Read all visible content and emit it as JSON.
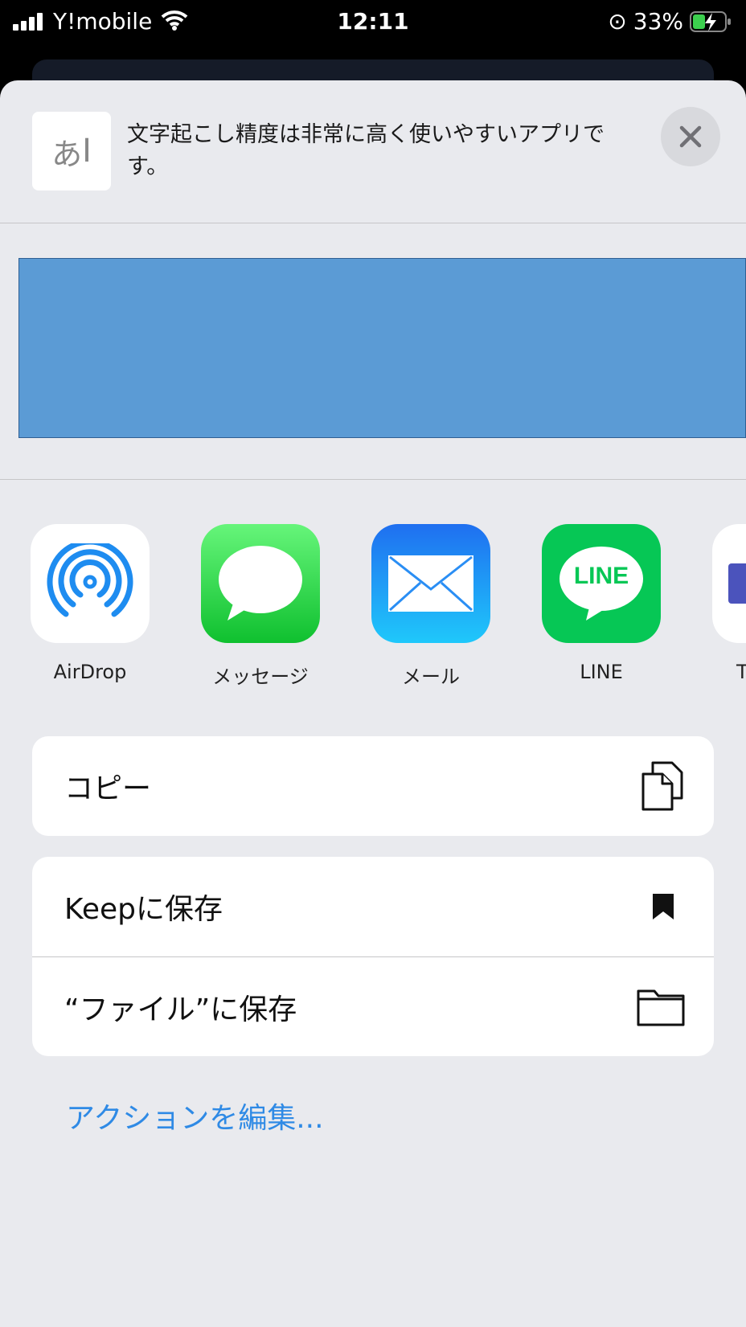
{
  "status_bar": {
    "carrier": "Y!mobile",
    "time": "12:11",
    "battery": "33%"
  },
  "header": {
    "thumbnail_glyph": "あ",
    "text": "文字起こし精度は非常に高く使いやすいアプリです。"
  },
  "preview": {
    "color": "#5b9bd5"
  },
  "apps": [
    {
      "label": "AirDrop",
      "icon": "airdrop-icon"
    },
    {
      "label": "メッセージ",
      "icon": "messages-icon"
    },
    {
      "label": "メール",
      "icon": "mail-icon"
    },
    {
      "label": "LINE",
      "icon": "line-icon",
      "logo_text": "LINE"
    },
    {
      "label": "T",
      "icon": "partial-app-icon"
    }
  ],
  "actions": [
    {
      "label": "コピー",
      "icon": "copy-icon"
    },
    {
      "label": "Keepに保存",
      "icon": "bookmark-icon"
    },
    {
      "label": "“ファイル”に保存",
      "icon": "folder-icon"
    }
  ],
  "edit_actions": "アクションを編集..."
}
